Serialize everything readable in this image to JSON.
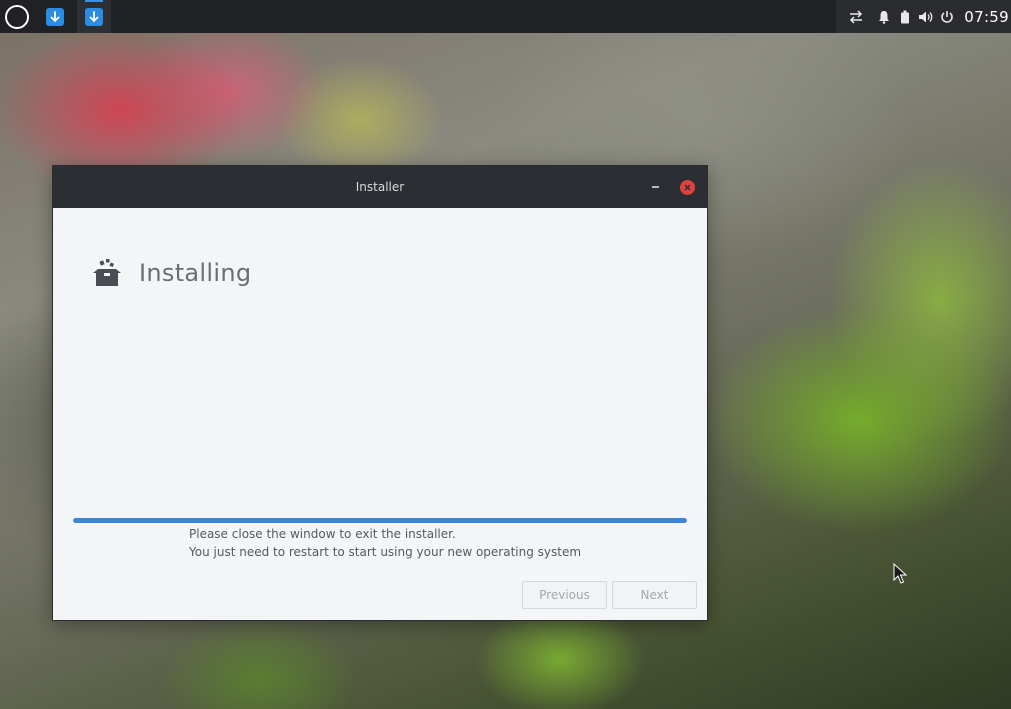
{
  "panel": {
    "launcher_icon": "circle-launcher-icon",
    "tasks": [
      {
        "name": "installer-task",
        "icon": "download-arrow-icon",
        "active": false
      },
      {
        "name": "installer-task-active",
        "icon": "download-arrow-icon",
        "active": true
      }
    ],
    "tray_icons": [
      "network-transfer-icon",
      "notification-bell-icon",
      "battery-icon",
      "volume-icon",
      "power-icon"
    ],
    "clock": "07:59"
  },
  "window": {
    "title": "Installer",
    "minimize_icon": "minimize-icon",
    "close_icon": "close-icon",
    "header": {
      "icon": "package-box-icon",
      "title": "Installing"
    },
    "progress": {
      "percent": 100
    },
    "status_lines": [
      "Please close the window to exit the installer.",
      "You just need to restart to start using your new operating system"
    ],
    "buttons": {
      "previous": "Previous",
      "next": "Next"
    },
    "colors": {
      "accent": "#3b86d6",
      "close": "#e0423e"
    }
  }
}
